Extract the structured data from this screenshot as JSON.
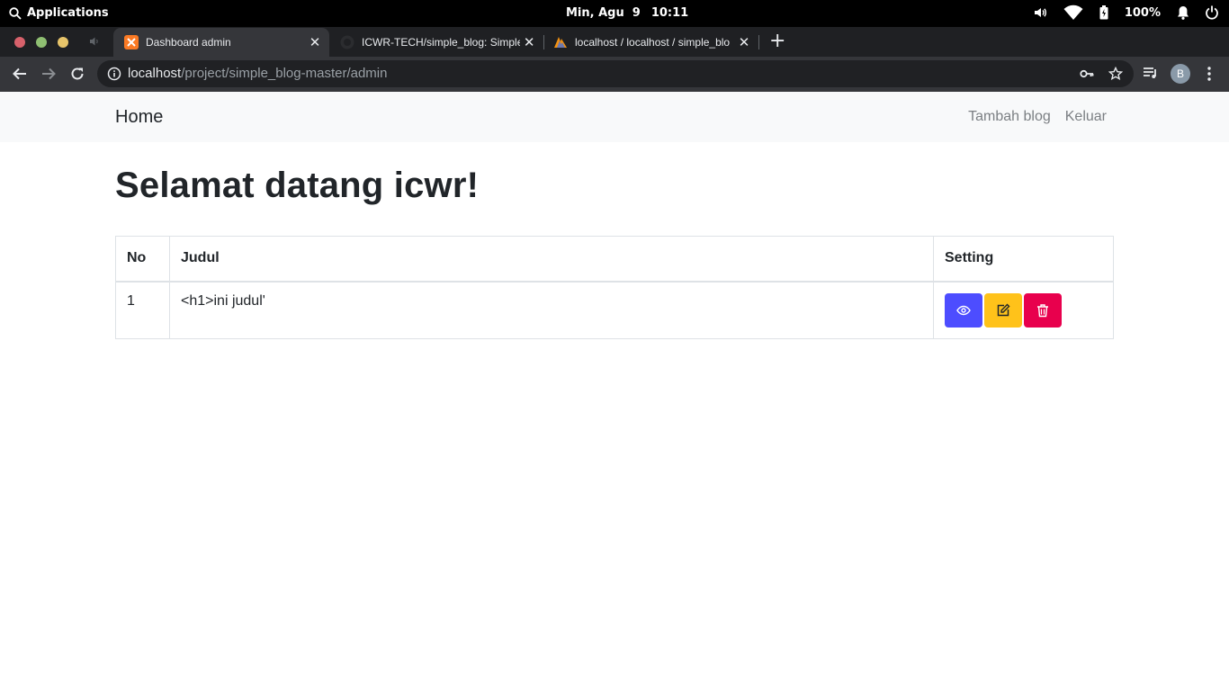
{
  "system_bar": {
    "applications_label": "Applications",
    "date": "Min, Agu  9",
    "time": "10:11",
    "battery": "100%"
  },
  "browser": {
    "tabs": [
      {
        "title": "Dashboard admin",
        "active": true
      },
      {
        "title": "ICWR-TECH/simple_blog: Simple",
        "active": false
      },
      {
        "title": "localhost / localhost / simple_blo",
        "active": false
      }
    ],
    "url_host": "localhost",
    "url_path": "/project/simple_blog-master/admin",
    "profile_initial": "B"
  },
  "navbar": {
    "brand": "Home",
    "links": [
      "Tambah blog",
      "Keluar"
    ]
  },
  "main": {
    "heading": "Selamat datang icwr!",
    "table": {
      "headers": [
        "No",
        "Judul",
        "Setting"
      ],
      "rows": [
        {
          "no": "1",
          "judul": "<h1>ini judul'"
        }
      ]
    }
  },
  "colors": {
    "view_button": "#4d4dff",
    "edit_button": "#ffc21a",
    "delete_button": "#e8004d",
    "navbar_bg": "#f8f9fa"
  },
  "icons": {
    "view": "eye-icon",
    "edit": "edit-icon",
    "delete": "trash-icon"
  }
}
